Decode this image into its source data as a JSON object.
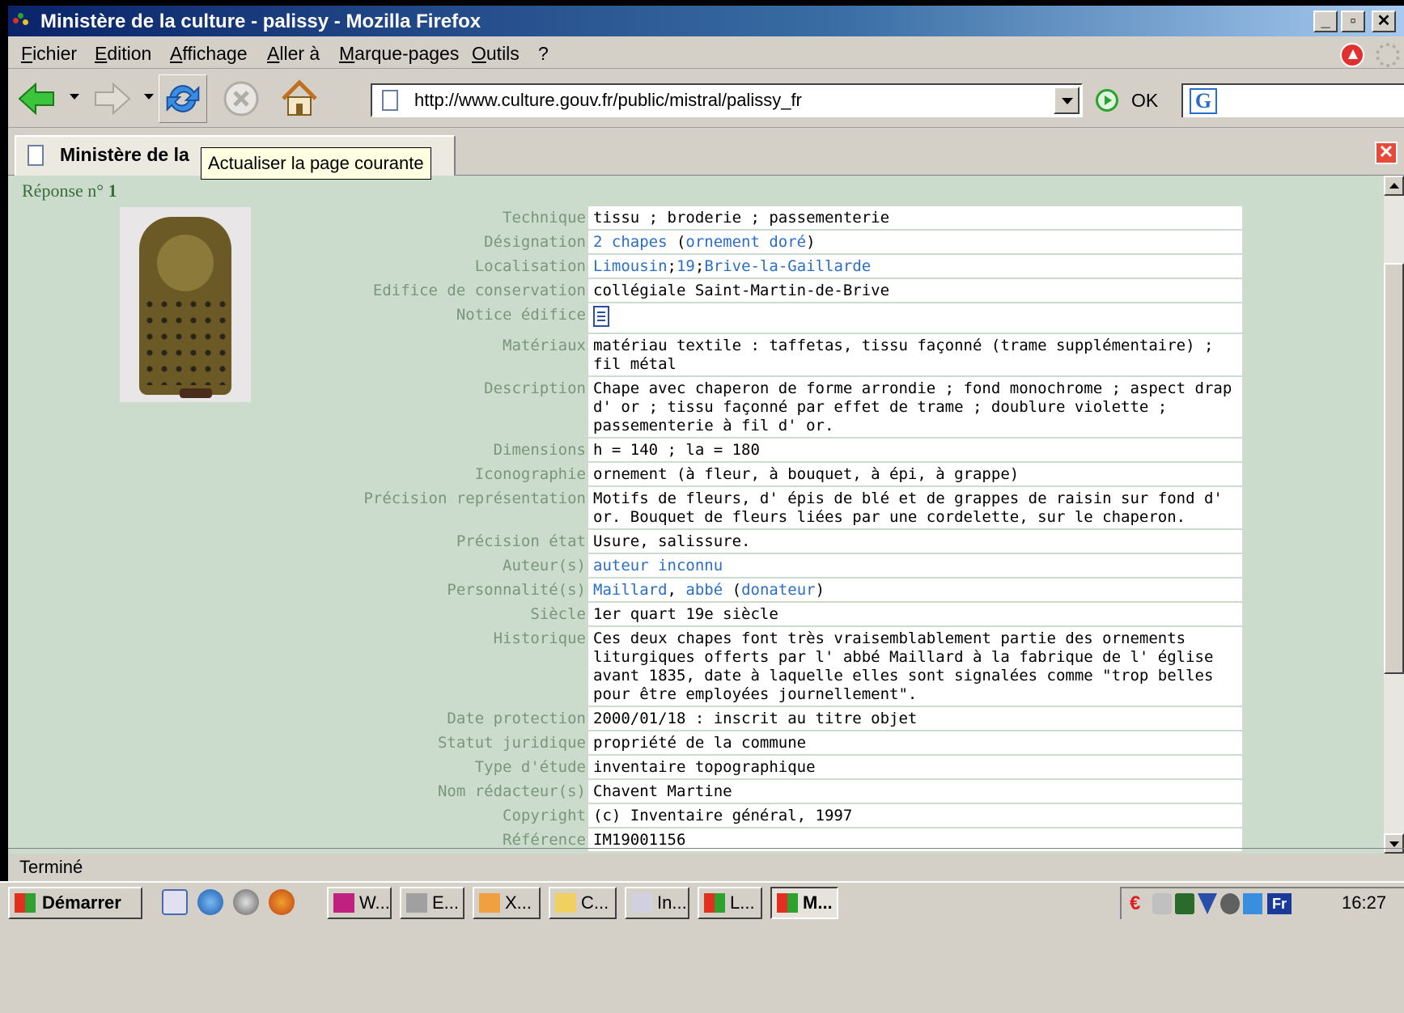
{
  "window": {
    "title": "Ministère de la culture - palissy - Mozilla Firefox",
    "controls": {
      "minimize": "_",
      "maximize": "▫",
      "close": "✕"
    }
  },
  "menu": [
    "Fichier",
    "Edition",
    "Affichage",
    "Aller à",
    "Marque-pages",
    "Outils",
    "?"
  ],
  "navigation": {
    "url": "http://www.culture.gouv.fr/public/mistral/palissy_fr",
    "go_label": "OK",
    "icons": [
      "back-icon",
      "forward-icon",
      "reload-icon",
      "stop-icon",
      "home-icon",
      "go-icon",
      "google-search-icon"
    ]
  },
  "tab": {
    "title": "Ministère de la",
    "tooltip": "Actualiser la page courante",
    "close": "✕"
  },
  "record": {
    "response_label": "Réponse n°",
    "response_number": "1",
    "fields": [
      {
        "label": "Technique",
        "value": "tissu ; broderie ; passementerie"
      },
      {
        "label": "Désignation",
        "parts": [
          {
            "text": "2 chapes",
            "link": true
          },
          {
            "text": " (",
            "link": false
          },
          {
            "text": "ornement doré",
            "link": true
          },
          {
            "text": ")",
            "link": false
          }
        ]
      },
      {
        "label": "Localisation",
        "parts": [
          {
            "text": "Limousin",
            "link": true
          },
          {
            "text": ";",
            "link": false
          },
          {
            "text": "19",
            "link": true
          },
          {
            "text": ";",
            "link": false
          },
          {
            "text": "Brive-la-Gaillarde",
            "link": true
          }
        ]
      },
      {
        "label": "Edifice de conservation",
        "value": "collégiale Saint-Martin-de-Brive"
      },
      {
        "label": "Notice édifice",
        "icon": "document-icon"
      },
      {
        "label": "Matériaux",
        "value": "matériau textile : taffetas, tissu façonné (trame supplémentaire) ; fil métal"
      },
      {
        "label": "Description",
        "value": "Chape avec chaperon de forme arrondie ; fond monochrome ; aspect drap d' or ; tissu façonné par effet de trame ; doublure violette ; passementerie à fil d' or."
      },
      {
        "label": "Dimensions",
        "value": "h = 140 ; la = 180"
      },
      {
        "label": "Iconographie",
        "value": "ornement (à fleur, à bouquet, à épi, à grappe)"
      },
      {
        "label": "Précision représentation",
        "value": "Motifs de fleurs, d' épis de blé et de grappes de raisin sur fond d' or. Bouquet de fleurs liées par une cordelette, sur le chaperon."
      },
      {
        "label": "Précision état",
        "value": "Usure, salissure."
      },
      {
        "label": "Auteur(s)",
        "parts": [
          {
            "text": "auteur inconnu",
            "link": true
          }
        ]
      },
      {
        "label": "Personnalité(s)",
        "parts": [
          {
            "text": "Maillard",
            "link": true
          },
          {
            "text": ", ",
            "link": false
          },
          {
            "text": "abbé",
            "link": true
          },
          {
            "text": " (",
            "link": false
          },
          {
            "text": "donateur",
            "link": true
          },
          {
            "text": ")",
            "link": false
          }
        ]
      },
      {
        "label": "Siècle",
        "value": "1er quart 19e siècle"
      },
      {
        "label": "Historique",
        "value": "Ces deux chapes font très vraisemblablement partie des ornements liturgiques offerts par l' abbé Maillard à la fabrique de l' église avant 1835, date à laquelle elles sont signalées comme \"trop belles pour être employées journellement\"."
      },
      {
        "label": "Date protection",
        "value": "2000/01/18 : inscrit au titre objet"
      },
      {
        "label": "Statut juridique",
        "value": "propriété de la commune"
      },
      {
        "label": "Type d'étude",
        "value": "inventaire topographique"
      },
      {
        "label": "Nom rédacteur(s)",
        "value": "Chavent Martine"
      },
      {
        "label": "Copyright",
        "value": "(c) Inventaire général, 1997"
      },
      {
        "label": "Référence",
        "value": "IM19001156"
      }
    ]
  },
  "status": "Terminé",
  "taskbar": {
    "start": "Démarrer",
    "quicklaunch": [
      "edit-icon",
      "internet-explorer-icon",
      "network-icon",
      "firefox-icon"
    ],
    "buttons": [
      "W...",
      "E...",
      "X...",
      "C...",
      "In...",
      "L...",
      "M..."
    ],
    "active_index": 6,
    "tray": [
      "euro-icon",
      "volume-icon",
      "network-tray-icon",
      "shield-tray-icon",
      "tools-tray-icon",
      "monitor-tray-icon"
    ],
    "language": "Fr",
    "clock": "16:27"
  },
  "colors": {
    "content_bg": "#ccdccc",
    "label_text": "#7a967a",
    "link": "#2a6ec8",
    "response_text": "#3b6b3b"
  }
}
